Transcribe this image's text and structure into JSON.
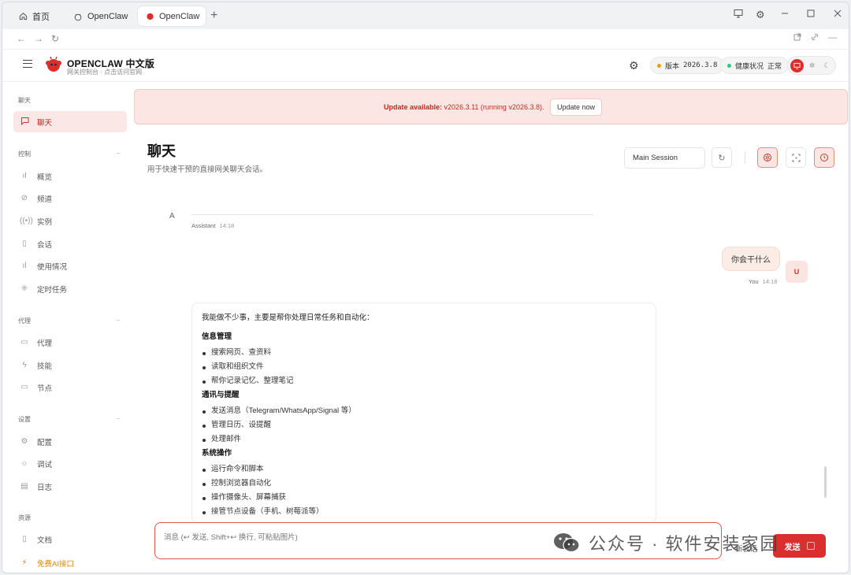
{
  "tabs": [
    {
      "label": "首页",
      "icon": "home-icon",
      "active": false
    },
    {
      "label": "OpenClaw",
      "icon": "claw-icon",
      "active": false
    },
    {
      "label": "OpenClaw",
      "icon": "openclaw-logo-icon",
      "active": true
    }
  ],
  "window_controls": {
    "monitor": "monitor-icon",
    "settings": "gear-icon",
    "minimize": "minimize-icon",
    "maximize": "maximize-icon",
    "close": "close-icon"
  },
  "header": {
    "brand": "OPENCLAW 中文版",
    "subtitle": "网关控制台 · 点击访问官网",
    "version_label": "版本",
    "version_value": "2026.3.8",
    "health_label": "健康状况",
    "health_value": "正常",
    "colors": {
      "accent": "#d92f2f",
      "version_dot": "#f39c12",
      "health_dot": "#2ecc71"
    }
  },
  "sidebar": {
    "sections": [
      {
        "title": "聊天",
        "items": [
          {
            "label": "聊天",
            "icon": "chat-icon",
            "active": true
          }
        ]
      },
      {
        "title": "控制",
        "items": [
          {
            "label": "概览",
            "icon": "bar-chart-icon"
          },
          {
            "label": "频道",
            "icon": "link-icon"
          },
          {
            "label": "实例",
            "icon": "radio-icon"
          },
          {
            "label": "会话",
            "icon": "document-icon"
          },
          {
            "label": "使用情况",
            "icon": "bar-chart-icon"
          },
          {
            "label": "定时任务",
            "icon": "loader-icon"
          }
        ]
      },
      {
        "title": "代理",
        "items": [
          {
            "label": "代理",
            "icon": "folder-icon"
          },
          {
            "label": "技能",
            "icon": "bolt-icon"
          },
          {
            "label": "节点",
            "icon": "monitor-icon"
          }
        ]
      },
      {
        "title": "设置",
        "items": [
          {
            "label": "配置",
            "icon": "gear-icon"
          },
          {
            "label": "调试",
            "icon": "bug-icon"
          },
          {
            "label": "日志",
            "icon": "log-icon"
          }
        ]
      },
      {
        "title": "资源",
        "items": [
          {
            "label": "文档",
            "icon": "book-icon"
          },
          {
            "label": "免费AI接口",
            "icon": "lightning-icon",
            "promo": true
          }
        ]
      }
    ]
  },
  "banner": {
    "title": "Update available:",
    "text": "v2026.3.11 (running v2026.3.8).",
    "button": "Update now"
  },
  "page": {
    "title": "聊天",
    "subtitle": "用于快速干预的直接网关聊天会话。"
  },
  "toolbar": {
    "session": "Main Session"
  },
  "chat": {
    "assistant_initial": "A",
    "assistant_name": "Assistant",
    "assistant_time": "14:18",
    "user_message": "你会干什么",
    "user_name": "You",
    "user_time": "14:18",
    "user_initial": "U",
    "reply": {
      "intro": "我能做不少事，主要是帮你处理日常任务和自动化：",
      "groups": [
        {
          "heading": "信息管理",
          "items": [
            "搜索网页、查资料",
            "读取和组织文件",
            "帮你记录记忆、整理笔记"
          ]
        },
        {
          "heading": "通讯与提醒",
          "items": [
            "发送消息（Telegram/WhatsApp/Signal 等）",
            "管理日历、设提醒",
            "处理邮件"
          ]
        },
        {
          "heading": "系统操作",
          "items": [
            "运行命令和脚本",
            "控制浏览器自动化",
            "操作摄像头、屏幕捕获",
            "接管节点设备（手机、树莓派等）"
          ]
        }
      ]
    }
  },
  "composer": {
    "placeholder": "消息 (↩ 发送, Shift+↩ 换行, 可粘贴图片)",
    "new_session": "新会话",
    "send": "发送"
  },
  "watermark": {
    "text": "公众号 · 软件安装家园"
  }
}
